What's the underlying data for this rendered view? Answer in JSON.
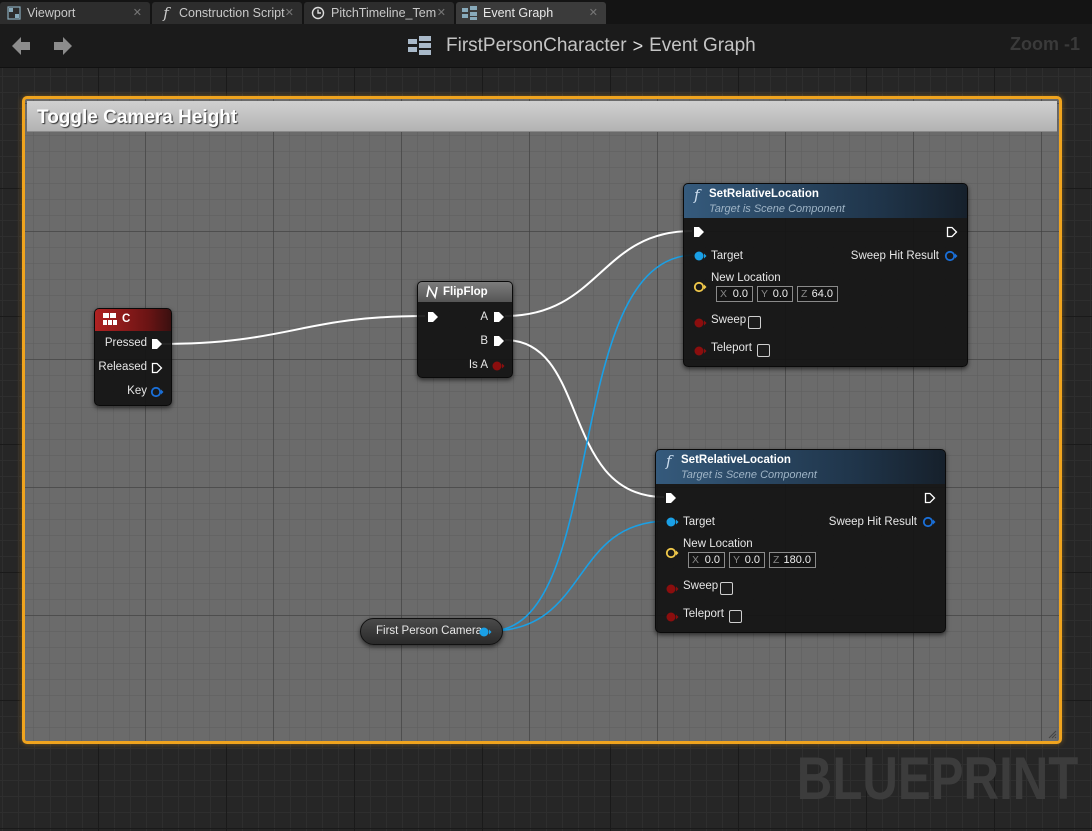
{
  "tabs": [
    {
      "label": "Viewport",
      "icon": "viewport-icon"
    },
    {
      "label": "Construction Script",
      "icon": "function-icon"
    },
    {
      "label": "PitchTimeline_Tem",
      "icon": "clock-icon"
    },
    {
      "label": "Event Graph",
      "icon": "graph-icon"
    }
  ],
  "breadcrumb": {
    "blueprint": "FirstPersonCharacter",
    "graph": "Event Graph",
    "separator": ">"
  },
  "zoom": "Zoom -1",
  "watermark": "BLUEPRINT",
  "comment": {
    "title": "Toggle Camera Height",
    "border_color": "#f0a41e"
  },
  "nodes": {
    "key_event": {
      "title": "C",
      "pins": {
        "pressed": "Pressed",
        "released": "Released",
        "key": "Key"
      }
    },
    "flipflop": {
      "title": "FlipFlop",
      "pins": {
        "a": "A",
        "b": "B",
        "is_a": "Is A"
      }
    },
    "set_location_1": {
      "title": "SetRelativeLocation",
      "subtitle": "Target is Scene Component",
      "target": "Target",
      "sweep_hit": "Sweep Hit Result",
      "new_location": "New Location",
      "x": "0.0",
      "y": "0.0",
      "z": "64.0",
      "sweep": "Sweep",
      "teleport": "Teleport"
    },
    "set_location_2": {
      "title": "SetRelativeLocation",
      "subtitle": "Target is Scene Component",
      "target": "Target",
      "sweep_hit": "Sweep Hit Result",
      "new_location": "New Location",
      "x": "0.0",
      "y": "0.0",
      "z": "180.0",
      "sweep": "Sweep",
      "teleport": "Teleport"
    },
    "camera_ref": {
      "label": "First Person Camera"
    }
  },
  "axis_labels": {
    "x": "X",
    "y": "Y",
    "z": "Z"
  },
  "colors": {
    "exec_wire": "#ffffff",
    "object_wire": "#1aa0e6",
    "key_header": "#b02222",
    "function_header": "#2e4f6e",
    "vector_pin": "#f0c84a",
    "bool_pin": "#8b0e0e"
  }
}
